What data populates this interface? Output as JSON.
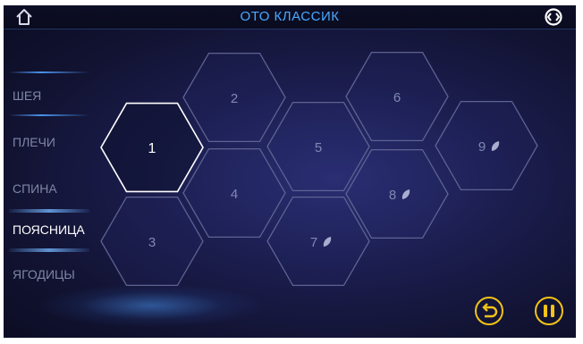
{
  "header": {
    "title": "ОТО КЛАССИК",
    "home_icon": "home-icon",
    "sync_icon": "sync-icon"
  },
  "sidebar": {
    "items": [
      {
        "label": "ШЕЯ",
        "active": false
      },
      {
        "label": "ПЛЕЧИ",
        "active": false
      },
      {
        "label": "СПИНА",
        "active": false
      },
      {
        "label": "ПОЯСНИЦА",
        "active": true
      },
      {
        "label": "ЯГОДИЦЫ",
        "active": false
      }
    ]
  },
  "programs": [
    {
      "label": "1",
      "selected": true,
      "leaf": false
    },
    {
      "label": "2",
      "selected": false,
      "leaf": false
    },
    {
      "label": "3",
      "selected": false,
      "leaf": false
    },
    {
      "label": "4",
      "selected": false,
      "leaf": false
    },
    {
      "label": "5",
      "selected": false,
      "leaf": false
    },
    {
      "label": "6",
      "selected": false,
      "leaf": false
    },
    {
      "label": "7",
      "selected": false,
      "leaf": true
    },
    {
      "label": "8",
      "selected": false,
      "leaf": true
    },
    {
      "label": "9",
      "selected": false,
      "leaf": true
    }
  ],
  "controls": {
    "back_icon": "return-arrow-icon",
    "pause_icon": "pause-icon",
    "accent_color": "#f3c317"
  },
  "colors": {
    "title": "#4aa8ff",
    "selected_hex": "#ffffff",
    "hex_outline": "#5d6392"
  }
}
